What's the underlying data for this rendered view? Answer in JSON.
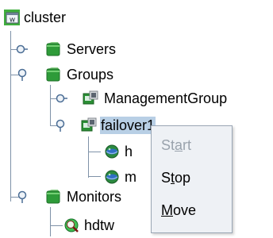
{
  "tree": {
    "root": {
      "label": "cluster",
      "icon": "cluster-icon"
    },
    "servers": {
      "label": "Servers",
      "icon": "folder-icon"
    },
    "groups": {
      "label": "Groups",
      "icon": "folder-icon"
    },
    "management_group": {
      "label": "ManagementGroup",
      "icon": "group-icon"
    },
    "failover_group": {
      "label": "failover1",
      "icon": "group-icon"
    },
    "resource_1": {
      "label": "h",
      "icon": "resource-icon"
    },
    "resource_2": {
      "label": "m",
      "icon": "resource-icon"
    },
    "monitors": {
      "label": "Monitors",
      "icon": "folder-icon"
    },
    "monitor_1": {
      "label": "hdtw",
      "icon": "monitor-icon"
    }
  },
  "context_menu": {
    "items": [
      {
        "label": "Start",
        "mnemonic": "a",
        "enabled": false
      },
      {
        "label": "Stop",
        "mnemonic": "t",
        "enabled": true
      },
      {
        "label": "Move",
        "mnemonic": "M",
        "enabled": true
      }
    ]
  },
  "colors": {
    "tree_line": "#7f92a8",
    "selection": "#b8cfe5",
    "folder_green": "#2e9b39",
    "menu_background": "#eef1f5",
    "menu_disabled_text": "#9aa3ad"
  }
}
